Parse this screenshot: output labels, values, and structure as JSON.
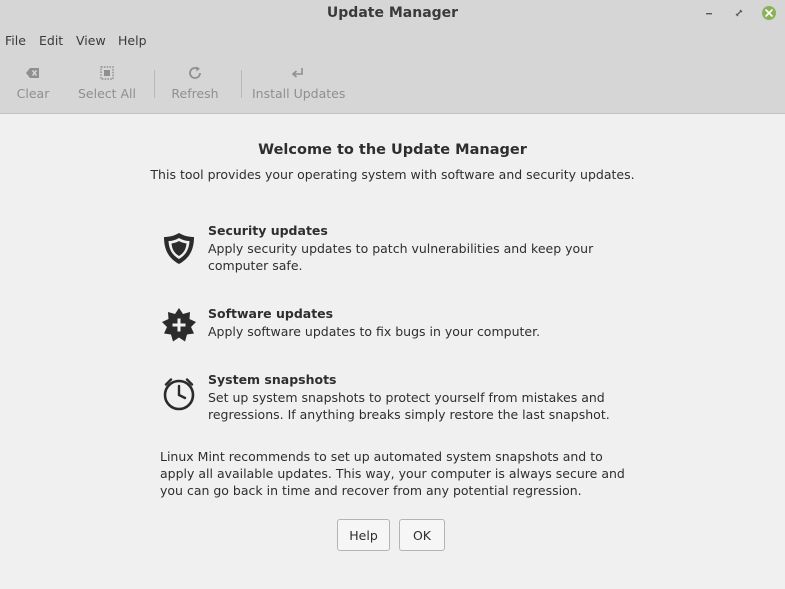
{
  "window": {
    "title": "Update Manager"
  },
  "menu": {
    "file": "File",
    "edit": "Edit",
    "view": "View",
    "help": "Help"
  },
  "toolbar": {
    "clear": "Clear",
    "select_all": "Select All",
    "refresh": "Refresh",
    "install_updates": "Install Updates"
  },
  "welcome": {
    "title": "Welcome to the Update Manager",
    "subtitle": "This tool provides your operating system with software and security updates."
  },
  "features": [
    {
      "title": "Security updates",
      "description": "Apply security updates to patch vulnerabilities and keep your computer safe.",
      "icon": "shield-icon"
    },
    {
      "title": "Software updates",
      "description": "Apply software updates to fix bugs in your computer.",
      "icon": "badge-plus-icon"
    },
    {
      "title": "System snapshots",
      "description": "Set up system snapshots to protect yourself from mistakes and regressions. If anything breaks simply restore the last snapshot.",
      "icon": "clock-icon"
    }
  ],
  "recommendation": "Linux Mint recommends to set up automated system snapshots and to apply all available updates. This way, your computer is always secure and you can go back in time and recover from any potential regression.",
  "buttons": {
    "help": "Help",
    "ok": "OK"
  },
  "colors": {
    "titlebar": "#d6d6d6",
    "content_bg": "#f0f0f0",
    "close_button": "#8bb158",
    "disabled_text": "#8f8f8f"
  }
}
